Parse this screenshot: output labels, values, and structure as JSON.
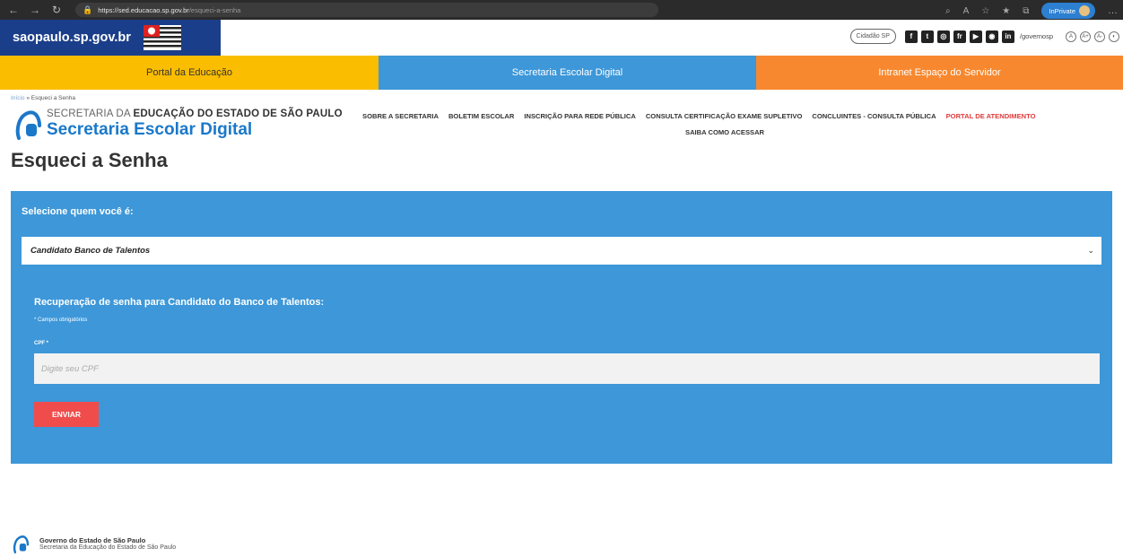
{
  "browser": {
    "url_host": "https://sed.educacao.sp.gov.br",
    "url_path": "/esqueci-a-senha",
    "inprivate_label": "InPrivate"
  },
  "gov": {
    "logo_text": "saopaulo.sp.gov.br",
    "cidadao_label": "Cidadão SP",
    "social_icons": [
      "f",
      "t",
      "◎",
      "fr",
      "▶",
      "◉",
      "in"
    ],
    "handle": "/governosp",
    "accessibility": [
      "A",
      "A+",
      "A-",
      "◐"
    ]
  },
  "portal_tabs": [
    {
      "label": "Portal da Educação",
      "color": "#fbbd00"
    },
    {
      "label": "Secretaria Escolar Digital",
      "color": "#3d97d8"
    },
    {
      "label": "Intranet Espaço do Servidor",
      "color": "#f7882f"
    }
  ],
  "breadcrumb": {
    "home": "Início",
    "separator": " » ",
    "current": "Esqueci a Senha"
  },
  "header": {
    "line1_prefix": "SECRETARIA DA ",
    "line1_bold": "EDUCAÇÃO DO ESTADO DE SÃO PAULO",
    "line2": "Secretaria Escolar Digital",
    "nav": [
      "SOBRE A SECRETARIA",
      "BOLETIM ESCOLAR",
      "INSCRIÇÃO PARA REDE PÚBLICA",
      "CONSULTA CERTIFICAÇÃO EXAME SUPLETIVO",
      "CONCLUINTES - CONSULTA PÚBLICA",
      "PORTAL DE ATENDIMENTO"
    ],
    "nav_row2": "SAIBA COMO ACESSAR"
  },
  "page_title": "Esqueci a Senha",
  "form": {
    "select_label": "Selecione quem você é:",
    "select_value": "Candidato Banco de Talentos",
    "recovery_title": "Recuperação de senha para Candidato do Banco de Talentos:",
    "required_note": "* Campos obrigatórios",
    "cpf_label": "CPF *",
    "cpf_placeholder": "Digite seu CPF",
    "submit_label": "ENVIAR"
  },
  "footer": {
    "line1": "Governo do Estado de São Paulo",
    "line2": "Secretaria da Educação do Estado de São Paulo"
  },
  "colors": {
    "primary_blue": "#3d97d8",
    "gov_blue": "#1b3e8a",
    "submit_red": "#f04c4c",
    "nav_red": "#e03b3b"
  }
}
